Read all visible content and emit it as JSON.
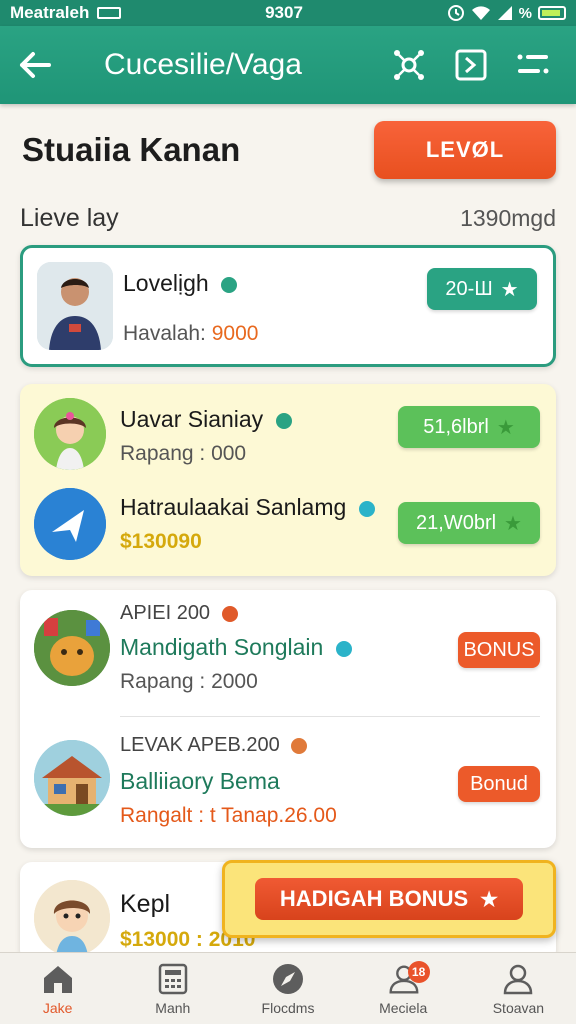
{
  "status": {
    "carrier": "Meatraleh",
    "time": "9307",
    "battery": "%"
  },
  "app_bar": {
    "title": "Cucesilie/Vaga"
  },
  "header": {
    "title": "Stuaiia Kanan",
    "level_button": "LEVØL"
  },
  "section": {
    "label": "Lieve lay",
    "value": "1390mgd"
  },
  "entries": [
    {
      "name": "Lovelịgh",
      "sub_label": "Havalah: ",
      "sub_value": "9000",
      "pill": "20-Ш"
    },
    {
      "name": "Uavar Sianiay",
      "sub": "Rapang : 000",
      "pill": "51,6lbrl"
    },
    {
      "name": "Hatraulaakai Sanlamg",
      "sub": "$130090",
      "pill": "21,W0brl"
    },
    {
      "upper": "APIEI 200",
      "name": "Mandigath Songlain",
      "sub": "Rapang : 2000",
      "pill": "BONUS"
    },
    {
      "upper": "LEVAK APEB.200",
      "name": "Balliiaory Bema",
      "sub": "Rangalt : t Tanap.26.00",
      "pill": "Bonud"
    },
    {
      "name": "Kepl",
      "sub": "$13000 : 2010"
    }
  ],
  "bonus_popup": {
    "label": "HADIGAH BONUS"
  },
  "bottom_nav": [
    {
      "label": "Jake",
      "icon": "home-icon"
    },
    {
      "label": "Manh",
      "icon": "calculator-icon"
    },
    {
      "label": "Flocdms",
      "icon": "compass-icon"
    },
    {
      "label": "Meciela",
      "icon": "people-icon",
      "badge": "18"
    },
    {
      "label": "Stoavan",
      "icon": "person-icon"
    }
  ],
  "colors": {
    "primary": "#2aa383",
    "accent": "#e8501f",
    "gold": "#d5a90c"
  }
}
